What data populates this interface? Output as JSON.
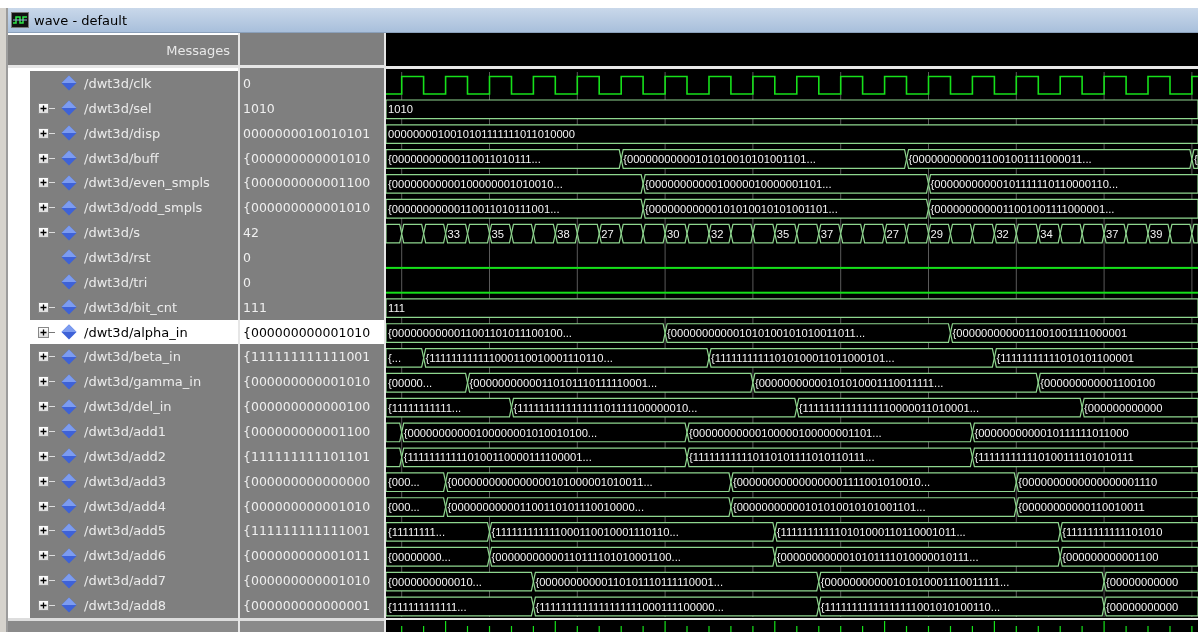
{
  "window": {
    "title": "wave - default"
  },
  "names_header": "Messages",
  "signals": [
    {
      "name": "/dwt3d/clk",
      "value": "0",
      "kind": "clock",
      "selected": false
    },
    {
      "name": "/dwt3d/sel",
      "value": "1010",
      "kind": "bus",
      "selected": false,
      "segments": [
        "1010"
      ]
    },
    {
      "name": "/dwt3d/disp",
      "value": "0000000010010101",
      "kind": "bus",
      "selected": false,
      "segments": [
        "0000000010010101111111011010000"
      ]
    },
    {
      "name": "/dwt3d/buff",
      "value": "{000000000001010",
      "kind": "bus",
      "selected": false,
      "segments": [
        "{00000000000110011010111...",
        "{00000000000101010010101001101...",
        "{0000000000011001001111000011...",
        "{"
      ]
    },
    {
      "name": "/dwt3d/even_smpls",
      "value": "{000000000001100",
      "kind": "bus",
      "selected": false,
      "segments": [
        "{00000000000100000001010010...",
        "{0000000000010000010000001101...",
        "{00000000000101111110110000110..."
      ]
    },
    {
      "name": "/dwt3d/odd_smpls",
      "value": "{000000000001010",
      "kind": "bus",
      "selected": false,
      "segments": [
        "{00000000000110011010111001...",
        "{00000000000101010010101001101...",
        "{0000000000011001001111000001..."
      ]
    },
    {
      "name": "/dwt3d/s",
      "value": "42",
      "kind": "bus",
      "selected": false,
      "segments": [
        {
          "kind": "blank"
        },
        {
          "kind": "blank"
        },
        {
          "kind": "blank"
        },
        {
          "kind": "value",
          "text": "33"
        },
        {
          "kind": "blank"
        },
        {
          "kind": "value",
          "text": "35"
        },
        {
          "kind": "blank"
        },
        {
          "kind": "blank"
        },
        {
          "kind": "value",
          "text": "38"
        },
        {
          "kind": "blank"
        },
        {
          "kind": "value",
          "text": "27"
        },
        {
          "kind": "blank"
        },
        {
          "kind": "blank"
        },
        {
          "kind": "value",
          "text": "30"
        },
        {
          "kind": "blank"
        },
        {
          "kind": "value",
          "text": "32"
        },
        {
          "kind": "blank"
        },
        {
          "kind": "blank"
        },
        {
          "kind": "value",
          "text": "35"
        },
        {
          "kind": "blank"
        },
        {
          "kind": "value",
          "text": "37"
        },
        {
          "kind": "blank"
        },
        {
          "kind": "blank"
        },
        {
          "kind": "value",
          "text": "27"
        },
        {
          "kind": "blank"
        },
        {
          "kind": "value",
          "text": "29"
        },
        {
          "kind": "blank"
        },
        {
          "kind": "blank"
        },
        {
          "kind": "value",
          "text": "32"
        },
        {
          "kind": "blank"
        },
        {
          "kind": "value",
          "text": "34"
        },
        {
          "kind": "blank"
        },
        {
          "kind": "blank"
        },
        {
          "kind": "value",
          "text": "37"
        },
        {
          "kind": "blank"
        },
        {
          "kind": "value",
          "text": "39"
        },
        {
          "kind": "blank"
        },
        {
          "kind": "blank"
        }
      ]
    },
    {
      "name": "/dwt3d/rst",
      "value": "0",
      "kind": "bit",
      "high": false,
      "selected": false
    },
    {
      "name": "/dwt3d/tri",
      "value": "0",
      "kind": "bit",
      "high": false,
      "selected": false
    },
    {
      "name": "/dwt3d/bit_cnt",
      "value": "111",
      "kind": "bus",
      "selected": false,
      "segments": [
        "111"
      ]
    },
    {
      "name": "/dwt3d/alpha_in",
      "value": "{000000000001010",
      "kind": "bus",
      "selected": true,
      "segments": [
        "{0000000000011001101011100100...",
        "{000000000001010100101010011011...",
        "{0000000000011001001111000001"
      ]
    },
    {
      "name": "/dwt3d/beta_in",
      "value": "{111111111111001",
      "kind": "bus",
      "selected": false,
      "segments": [
        "{...",
        "{111111111111000110010001110110...",
        "{11111111111010100011011000101...",
        "{11111111111010101100001"
      ]
    },
    {
      "name": "/dwt3d/gamma_in",
      "value": "{000000000001010",
      "kind": "bus",
      "selected": false,
      "segments": [
        "{00000...",
        "{00000000000110101110111110001...",
        "{00000000000101010001110011111...",
        "{000000000001100100"
      ]
    },
    {
      "name": "/dwt3d/del_in",
      "value": "{000000000000100",
      "kind": "bus",
      "selected": false,
      "segments": [
        "{11111111111...",
        "{111111111111111101111100000010...",
        "{11111111111111110000011010001...",
        "{000000000000"
      ]
    },
    {
      "name": "/dwt3d/add1",
      "value": "{000000000001100",
      "kind": "bus",
      "selected": false,
      "segments": [
        {
          "kind": "blank"
        },
        "{00000000000100000001010010100...",
        "{00000000000100000100000001101...",
        "{0000000000010111111011000"
      ]
    },
    {
      "name": "/dwt3d/add2",
      "value": "{111111111101101",
      "kind": "bus",
      "selected": false,
      "segments": [
        {
          "kind": "blank"
        },
        "{111111111110100110000111100001...",
        "{111111111110110101111010110111...",
        "{111111111110100111101010111"
      ]
    },
    {
      "name": "/dwt3d/add3",
      "value": "{000000000000000",
      "kind": "bus",
      "selected": false,
      "segments": [
        "{000...",
        "{0000000000000000101000001010011...",
        "{000000000000000001111001010010...",
        "{0000000000000000001110"
      ]
    },
    {
      "name": "/dwt3d/add4",
      "value": "{000000000001010",
      "kind": "bus",
      "selected": false,
      "segments": [
        "{000...",
        "{000000000001100110101110010000...",
        "{00000000000101010010101001101...",
        "{00000000000110010011"
      ]
    },
    {
      "name": "/dwt3d/add5",
      "value": "{111111111111001",
      "kind": "bus",
      "selected": false,
      "segments": [
        "{11111111...",
        "{111111111111000110010001110110...",
        "{111111111110101000110110001011...",
        "{11111111111101010"
      ]
    },
    {
      "name": "/dwt3d/add6",
      "value": "{000000000001011",
      "kind": "bus",
      "selected": false,
      "segments": [
        "{00000000...",
        "{00000000000110111101010001100...",
        "{0000000000010101111010000010111...",
        "{000000000001100"
      ]
    },
    {
      "name": "/dwt3d/add7",
      "value": "{000000000001010",
      "kind": "bus",
      "selected": false,
      "segments": [
        "{0000000000010...",
        "{00000000000110101110111110001...",
        "{00000000000101010001110011111...",
        "{00000000000"
      ]
    },
    {
      "name": "/dwt3d/add8",
      "value": "{000000000000001",
      "kind": "bus",
      "selected": false,
      "segments": [
        "{111111111111...",
        "{1111111111111111111000111100000...",
        "{11111111111111111001010100110...",
        "{00000000000"
      ]
    }
  ]
}
